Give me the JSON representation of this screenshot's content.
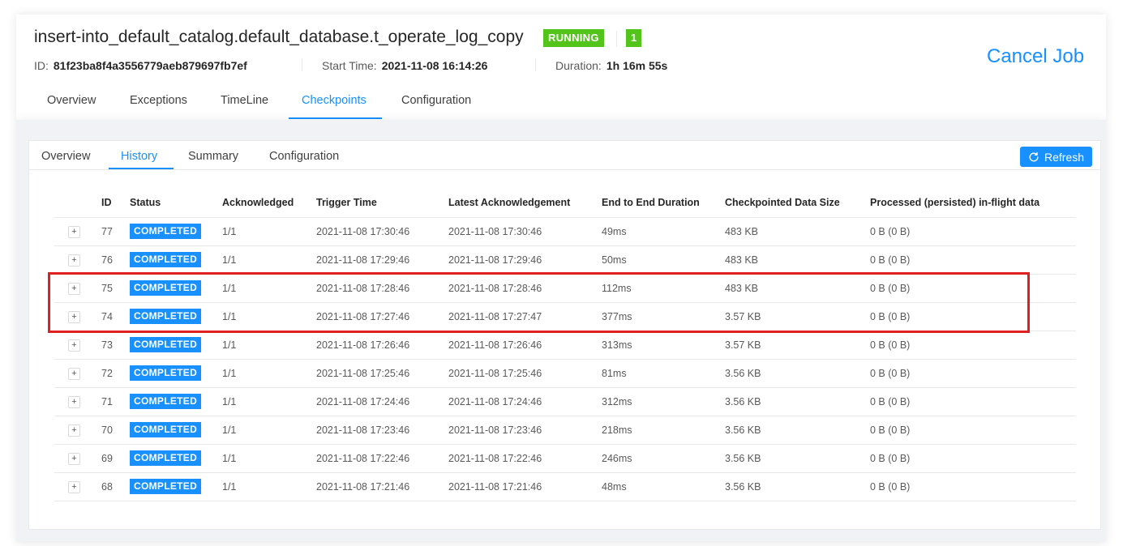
{
  "job": {
    "title": "insert-into_default_catalog.default_database.t_operate_log_copy",
    "status": "RUNNING",
    "status_color": "#52c41a",
    "task_count": "1",
    "id_label": "ID:",
    "id": "81f23ba8f4a3556779aeb879697fb7ef",
    "start_label": "Start Time:",
    "start_time": "2021-11-08 16:14:26",
    "duration_label": "Duration:",
    "duration": "1h 16m 55s",
    "cancel_label": "Cancel Job"
  },
  "tabs": [
    {
      "label": "Overview"
    },
    {
      "label": "Exceptions"
    },
    {
      "label": "TimeLine"
    },
    {
      "label": "Checkpoints"
    },
    {
      "label": "Configuration"
    }
  ],
  "active_tab": "Checkpoints",
  "subtabs": [
    {
      "label": "Overview"
    },
    {
      "label": "History"
    },
    {
      "label": "Summary"
    },
    {
      "label": "Configuration"
    }
  ],
  "active_subtab": "History",
  "refresh": {
    "label": "Refresh",
    "icon": "sync-icon"
  },
  "accent_color": "#1890ff",
  "highlight_color": "#e02020",
  "table": {
    "columns": [
      "ID",
      "Status",
      "Acknowledged",
      "Trigger Time",
      "Latest Acknowledgement",
      "End to End Duration",
      "Checkpointed Data Size",
      "Processed (persisted) in-flight data"
    ],
    "expand_symbol": "+",
    "rows": [
      {
        "id": "77",
        "status": "COMPLETED",
        "ack": "1/1",
        "trigger": "2021-11-08 17:30:46",
        "latest": "2021-11-08 17:30:46",
        "duration": "49ms",
        "size": "483 KB",
        "inflight": "0 B (0 B)"
      },
      {
        "id": "76",
        "status": "COMPLETED",
        "ack": "1/1",
        "trigger": "2021-11-08 17:29:46",
        "latest": "2021-11-08 17:29:46",
        "duration": "50ms",
        "size": "483 KB",
        "inflight": "0 B (0 B)"
      },
      {
        "id": "75",
        "status": "COMPLETED",
        "ack": "1/1",
        "trigger": "2021-11-08 17:28:46",
        "latest": "2021-11-08 17:28:46",
        "duration": "112ms",
        "size": "483 KB",
        "inflight": "0 B (0 B)"
      },
      {
        "id": "74",
        "status": "COMPLETED",
        "ack": "1/1",
        "trigger": "2021-11-08 17:27:46",
        "latest": "2021-11-08 17:27:47",
        "duration": "377ms",
        "size": "3.57 KB",
        "inflight": "0 B (0 B)"
      },
      {
        "id": "73",
        "status": "COMPLETED",
        "ack": "1/1",
        "trigger": "2021-11-08 17:26:46",
        "latest": "2021-11-08 17:26:46",
        "duration": "313ms",
        "size": "3.57 KB",
        "inflight": "0 B (0 B)"
      },
      {
        "id": "72",
        "status": "COMPLETED",
        "ack": "1/1",
        "trigger": "2021-11-08 17:25:46",
        "latest": "2021-11-08 17:25:46",
        "duration": "81ms",
        "size": "3.56 KB",
        "inflight": "0 B (0 B)"
      },
      {
        "id": "71",
        "status": "COMPLETED",
        "ack": "1/1",
        "trigger": "2021-11-08 17:24:46",
        "latest": "2021-11-08 17:24:46",
        "duration": "312ms",
        "size": "3.56 KB",
        "inflight": "0 B (0 B)"
      },
      {
        "id": "70",
        "status": "COMPLETED",
        "ack": "1/1",
        "trigger": "2021-11-08 17:23:46",
        "latest": "2021-11-08 17:23:46",
        "duration": "218ms",
        "size": "3.56 KB",
        "inflight": "0 B (0 B)"
      },
      {
        "id": "69",
        "status": "COMPLETED",
        "ack": "1/1",
        "trigger": "2021-11-08 17:22:46",
        "latest": "2021-11-08 17:22:46",
        "duration": "246ms",
        "size": "3.56 KB",
        "inflight": "0 B (0 B)"
      },
      {
        "id": "68",
        "status": "COMPLETED",
        "ack": "1/1",
        "trigger": "2021-11-08 17:21:46",
        "latest": "2021-11-08 17:21:46",
        "duration": "48ms",
        "size": "3.56 KB",
        "inflight": "0 B (0 B)"
      }
    ]
  }
}
